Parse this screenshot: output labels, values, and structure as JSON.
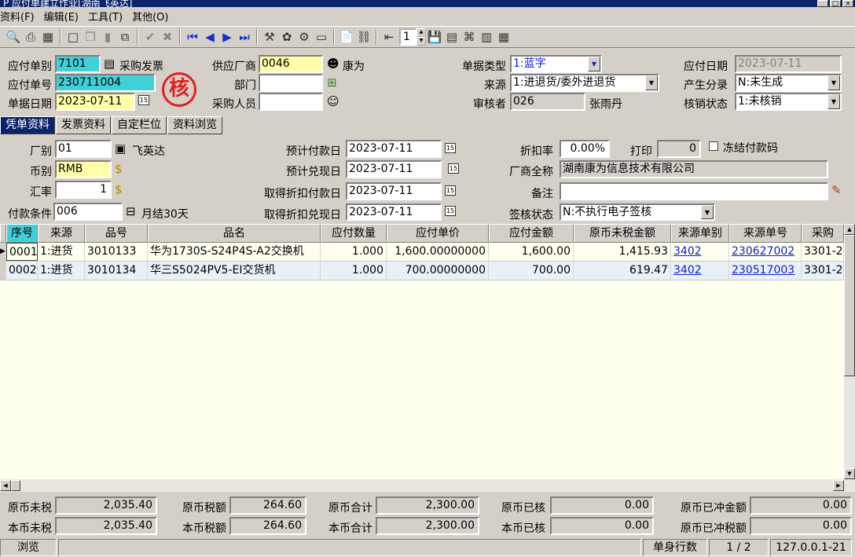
{
  "window": {
    "title": "P 应付单建立作业[湖南飞英达]"
  },
  "menu": [
    "资料(F)",
    "编辑(E)",
    "工具(T)",
    "其他(O)"
  ],
  "toolbar": {
    "page_value": "1"
  },
  "header": {
    "ap_type_label": "应付单别",
    "ap_type_value": "7101",
    "ap_type_desc": "采购发票",
    "ap_no_label": "应付单号",
    "ap_no_value": "230711004",
    "doc_date_label": "单据日期",
    "doc_date_value": "2023-07-11",
    "supplier_label": "供应厂商",
    "supplier_value": "0046",
    "supplier_name": "康为",
    "dept_label": "部门",
    "dept_value": "",
    "buyer_label": "采购人员",
    "buyer_value": "",
    "doc_kind_label": "单据类型",
    "doc_kind_value": "1:蓝字",
    "source_label": "来源",
    "source_value": "1:进退货/委外进退货",
    "reviewer_label": "审核者",
    "reviewer_code": "026",
    "reviewer_name": "张雨丹",
    "pay_date_label": "应付日期",
    "pay_date_value": "2023-07-11",
    "entry_label": "产生分录",
    "entry_value": "N:未生成",
    "writeoff_label": "核销状态",
    "writeoff_value": "1:未核销",
    "stamp_text": "核"
  },
  "tabs": [
    "凭单资料",
    "发票资料",
    "自定栏位",
    "资料浏览"
  ],
  "detail": {
    "factory_label": "厂别",
    "factory_value": "01",
    "factory_name": "飞英达",
    "currency_label": "币别",
    "currency_value": "RMB",
    "rate_label": "汇率",
    "rate_value": "1",
    "terms_label": "付款条件",
    "terms_value": "006",
    "terms_desc": "月结30天",
    "est_pay_label": "预计付款日",
    "est_pay_value": "2023-07-11",
    "est_cash_label": "预计兑现日",
    "est_cash_value": "2023-07-11",
    "disc_pay_label": "取得折扣付款日",
    "disc_pay_value": "2023-07-11",
    "disc_cash_label": "取得折扣兑现日",
    "disc_cash_value": "2023-07-11",
    "discount_label": "折扣率",
    "discount_value": "0.00%",
    "print_label": "打印",
    "print_value": "0",
    "freeze_label": "冻结付款码",
    "fullname_label": "厂商全称",
    "fullname_value": "湖南康为信息技术有限公司",
    "remark_label": "备注",
    "remark_value": "",
    "sign_label": "签核状态",
    "sign_value": "N:不执行电子签核"
  },
  "grid": {
    "columns": [
      "序号",
      "来源",
      "品号",
      "品名",
      "应付数量",
      "应付单价",
      "应付金额",
      "原币未税金额",
      "来源单别",
      "来源单号",
      "采购"
    ],
    "rows": [
      [
        "0001",
        "1:进货",
        "3010133",
        "华为1730S-S24P4S-A2交换机",
        "1.000",
        "1,600.00000000",
        "1,600.00",
        "1,415.93",
        "3402",
        "230627002",
        "3301-2"
      ],
      [
        "0002",
        "1:进货",
        "3010134",
        "华三S5024PV5-EI交货机",
        "1.000",
        "700.00000000",
        "700.00",
        "619.47",
        "3402",
        "230517003",
        "3301-2"
      ]
    ]
  },
  "totals": {
    "orig_untaxed_label": "原币未税",
    "orig_untaxed": "2,035.40",
    "orig_tax_label": "原币税额",
    "orig_tax": "264.60",
    "orig_total_label": "原币合计",
    "orig_total": "2,300.00",
    "orig_verified_label": "原币已核",
    "orig_verified": "0.00",
    "orig_offset_label": "原币已冲金额",
    "orig_offset": "0.00",
    "local_untaxed_label": "本币未税",
    "local_untaxed": "2,035.40",
    "local_tax_label": "本币税额",
    "local_tax": "264.60",
    "local_total_label": "本币合计",
    "local_total": "2,300.00",
    "local_verified_label": "本币已核",
    "local_verified": "0.00",
    "local_offset_label": "原币已冲税额",
    "local_offset": "0.00"
  },
  "status": {
    "mode": "浏览",
    "rows_label": "单身行数",
    "rows_value": "1 / 2",
    "server": "127.0.0.1-21"
  }
}
